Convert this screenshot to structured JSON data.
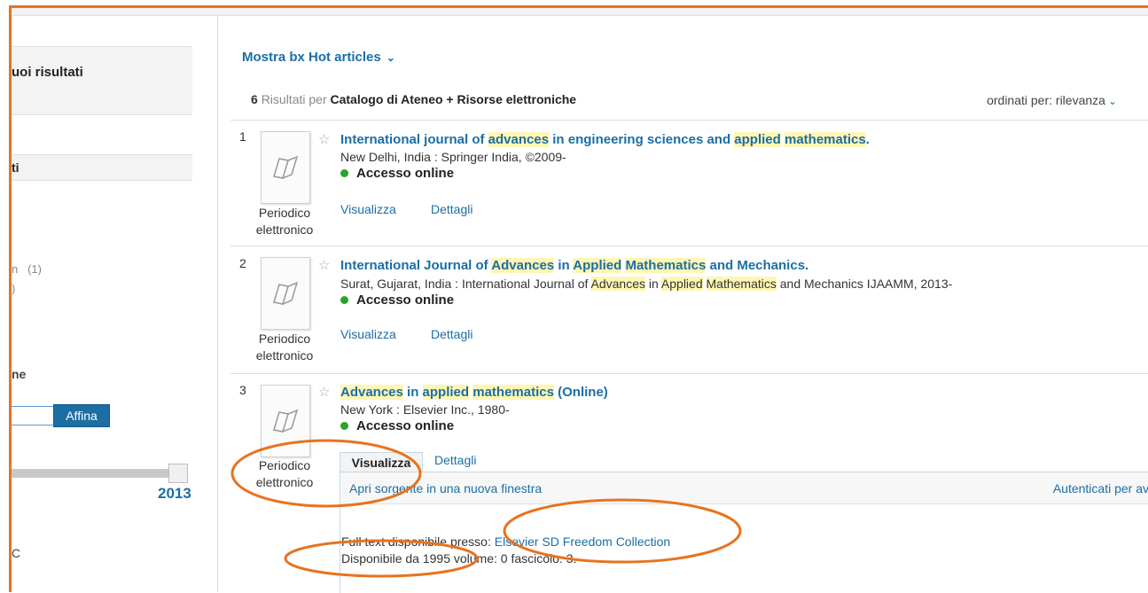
{
  "sidebar": {
    "header_fragment": "uoi risultati",
    "section_fragment": "ti",
    "count_1": "n   (1)",
    "count_2": ")",
    "section_ne": "ne",
    "affina_label": "Affina",
    "year_max": "2013",
    "bottom_fragment": "C"
  },
  "toolbar": {
    "mostra_label": "Mostra bx Hot articles",
    "results_count": "6",
    "results_word": "Risultati",
    "per_word": "per",
    "collection": "Catalogo di Ateneo + Risorse elettroniche",
    "sort_label": "ordinati per:",
    "sort_value": "rilevanza"
  },
  "results": [
    {
      "number": "1",
      "type": "Periodico elettronico",
      "title_parts": [
        "International journal of ",
        "advances",
        " in engineering sciences and ",
        "applied",
        " ",
        "mathematics",
        "."
      ],
      "publisher_parts": [
        "New Delhi, India : Springer India, ©2009-"
      ],
      "access": "Accesso online",
      "view_label": "Visualizza",
      "details_label": "Dettagli"
    },
    {
      "number": "2",
      "type": "Periodico elettronico",
      "title_parts": [
        "International Journal of ",
        "Advances",
        " in ",
        "Applied",
        " ",
        "Mathematics",
        " and Mechanics."
      ],
      "publisher_parts": [
        "Surat, Gujarat, India : International Journal of ",
        "Advances",
        " in ",
        "Applied",
        " ",
        "Mathematics",
        " and Mechanics IJAAMM, 2013-"
      ],
      "access": "Accesso online",
      "view_label": "Visualizza",
      "details_label": "Dettagli"
    },
    {
      "number": "3",
      "type": "Periodico elettronico",
      "title_parts": [
        "Advances",
        " in ",
        "applied",
        " ",
        "mathematics",
        " (Online)"
      ],
      "publisher_parts": [
        "New York : Elsevier Inc., 1980-"
      ],
      "access": "Accesso online",
      "view_label": "Visualizza",
      "details_label": "Dettagli"
    }
  ],
  "expanded": {
    "open_source_label": "Apri sorgente in una nuova finestra",
    "auth_label": "Autenticati per av",
    "fulltext_prefix": "Full text disponibile presso: ",
    "fulltext_link": "Elsevier SD Freedom Collection",
    "availability": "Disponibile da 1995 volume: 0 fascicolo: 3."
  },
  "colors": {
    "accent": "#1c6ea4",
    "highlight": "#fff6b3",
    "annotation": "#e8731f",
    "online_dot": "#2aa32a"
  },
  "icons": {
    "thumbnail": "book-icon",
    "favorite": "star-icon",
    "dropdown": "chevron-down-icon"
  }
}
